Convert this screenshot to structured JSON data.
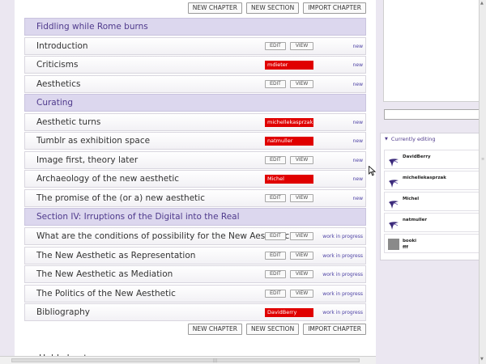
{
  "toolbar": {
    "new_chapter": "NEW CHAPTER",
    "new_section": "NEW SECTION",
    "import_chapter": "IMPORT CHAPTER"
  },
  "rows": [
    {
      "type": "section",
      "title": "Fiddling while Rome burns"
    },
    {
      "type": "chapter",
      "title": "Introduction",
      "edit": "EDIT",
      "view": "VIEW",
      "status": "new"
    },
    {
      "type": "chapter",
      "title": "Criticisms",
      "lock": "mdieter",
      "status": "new"
    },
    {
      "type": "chapter",
      "title": "Aesthetics",
      "edit": "EDIT",
      "view": "VIEW",
      "status": "new"
    },
    {
      "type": "section",
      "title": "Curating"
    },
    {
      "type": "chapter",
      "title": "Aesthetic turns",
      "lock": "michellekasprzak",
      "status": "new"
    },
    {
      "type": "chapter",
      "title": "Tumblr as exhibition space",
      "lock": "natmuller",
      "status": "new"
    },
    {
      "type": "chapter",
      "title": "Image first, theory later",
      "edit": "EDIT",
      "view": "VIEW",
      "status": "new"
    },
    {
      "type": "chapter",
      "title": "Archaeology of the new aesthetic",
      "lock": "Michel",
      "status": "new"
    },
    {
      "type": "chapter",
      "title": "The promise of the (or a) new aesthetic",
      "edit": "EDIT",
      "view": "VIEW",
      "status": "new"
    },
    {
      "type": "section",
      "title": "Section IV: Irruptions of the Digital into the Real"
    },
    {
      "type": "chapter",
      "title": "What are the conditions of possibility for the New Aesthetic?",
      "edit": "EDIT",
      "view": "VIEW",
      "status": "work in progress"
    },
    {
      "type": "chapter",
      "title": "The New Aesthetic as Representation",
      "edit": "EDIT",
      "view": "VIEW",
      "status": "work in progress"
    },
    {
      "type": "chapter",
      "title": "The New Aesthetic as Mediation",
      "edit": "EDIT",
      "view": "VIEW",
      "status": "work in progress"
    },
    {
      "type": "chapter",
      "title": "The Politics of the New Aesthetic",
      "edit": "EDIT",
      "view": "VIEW",
      "status": "work in progress"
    },
    {
      "type": "chapter",
      "title": "Bibliography",
      "lock": "DavidBerry",
      "status": "work in progress"
    }
  ],
  "below_text": "Hold chapters",
  "currently_editing": {
    "title": "Currently editing",
    "users": [
      {
        "name": "DavidBerry",
        "avatar": "booktype-bird-icon"
      },
      {
        "name": "michellekasprzak",
        "avatar": "booktype-bird-icon"
      },
      {
        "name": "Michel",
        "avatar": "booktype-bird-icon"
      },
      {
        "name": "natmuller",
        "avatar": "booktype-bird-icon"
      },
      {
        "name": "booki",
        "subtitle": "fff",
        "avatar": "user-photo-icon"
      }
    ]
  },
  "colors": {
    "lock_red": "#e00000",
    "section_bg": "#dcd7ee",
    "accent_purple": "#4f3a8c",
    "status_link": "#4a3ea3"
  }
}
